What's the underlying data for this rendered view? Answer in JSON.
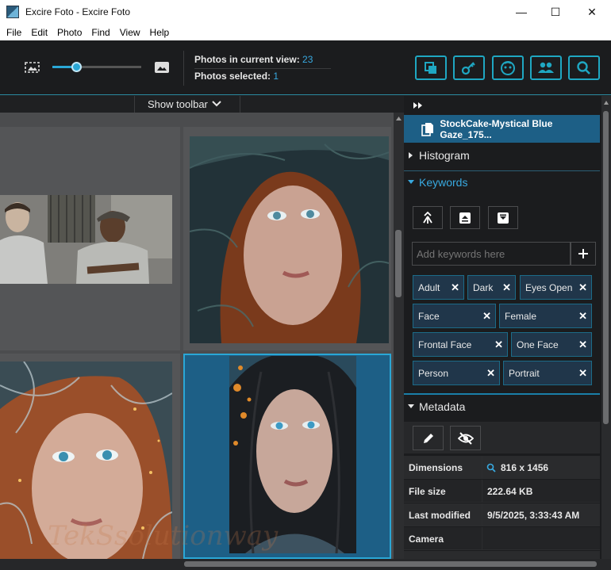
{
  "window": {
    "title": "Excire Foto - Excire Foto",
    "minimize": "—",
    "maximize": "☐",
    "close": "✕"
  },
  "menu": [
    "File",
    "Edit",
    "Photo",
    "Find",
    "View",
    "Help"
  ],
  "toolbar": {
    "stats": {
      "in_view_label": "Photos in current view: ",
      "in_view_value": "23",
      "selected_label": "Photos selected: ",
      "selected_value": "1"
    },
    "show_toolbar": "Show toolbar",
    "zoom_level": 0.27,
    "buttons": [
      "copy-icon",
      "key-icon",
      "face-icon",
      "people-icon",
      "search-icon"
    ]
  },
  "grid": {
    "photos": [
      {
        "name": "photo-two-men-prison-yard"
      },
      {
        "name": "photo-woman-red-hair-branches"
      },
      {
        "name": "photo-woman-blue-eyes-frost"
      },
      {
        "name": "photo-woman-blue-gaze-selected"
      }
    ],
    "watermark": "TekSsolutionway"
  },
  "panel": {
    "selected_file": "StockCake-Mystical Blue Gaze_175...",
    "sections": {
      "histogram": "Histogram",
      "keywords": "Keywords",
      "metadata": "Metadata"
    },
    "keyword_input_placeholder": "Add keywords here",
    "keywords": [
      "Adult",
      "Dark",
      "Eyes Open",
      "Face",
      "Female",
      "Frontal Face",
      "One Face",
      "Person",
      "Portrait"
    ],
    "metadata": [
      {
        "key": "Dimensions",
        "value": "816 x 1456"
      },
      {
        "key": "File size",
        "value": "222.64 KB"
      },
      {
        "key": "Last modified",
        "value": "9/5/2025, 3:33:43 AM"
      },
      {
        "key": "Camera",
        "value": ""
      }
    ]
  },
  "colors": {
    "accent": "#1fa7c2",
    "selection": "#1d5f86",
    "link": "#38a9e0"
  }
}
